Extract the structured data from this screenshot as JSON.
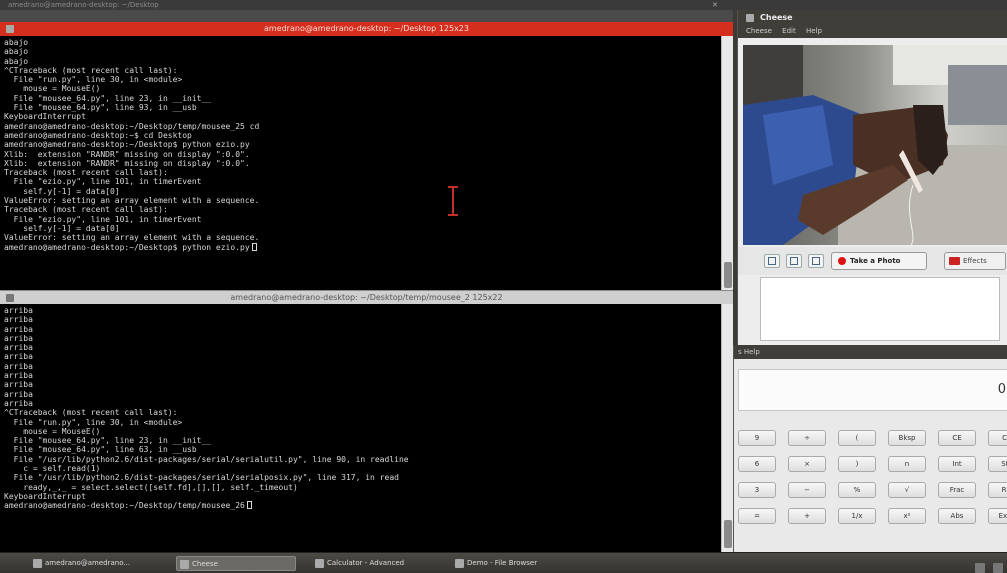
{
  "background_window": {
    "title": "amedrano@amedrano-desktop: ~/Desktop"
  },
  "terminal1": {
    "title": "amedrano@amedrano-desktop: ~/Desktop 125x23",
    "lines": [
      "abajo",
      "abajo",
      "abajo",
      "^CTraceback (most recent call last):",
      "  File \"run.py\", line 30, in <module>",
      "    mouse = MouseE()",
      "  File \"mousee_64.py\", line 23, in __init__",
      "  File \"mousee_64.py\", line 93, in __usb",
      "KeyboardInterrupt",
      "amedrano@amedrano-desktop:~/Desktop/temp/mousee_25 cd",
      "amedrano@amedrano-desktop:~$ cd Desktop",
      "amedrano@amedrano-desktop:~/Desktop$ python ezio.py",
      "Xlib:  extension \"RANDR\" missing on display \":0.0\".",
      "Xlib:  extension \"RANDR\" missing on display \":0.0\".",
      "Traceback (most recent call last):",
      "  File \"ezio.py\", line 101, in timerEvent",
      "    self.y[-1] = data[0]",
      "ValueError: setting an array element with a sequence.",
      "Traceback (most recent call last):",
      "  File \"ezio.py\", line 101, in timerEvent",
      "    self.y[-1] = data[0]",
      "ValueError: setting an array element with a sequence.",
      "amedrano@amedrano-desktop:~/Desktop$ python ezio.py"
    ]
  },
  "terminal2": {
    "title": "amedrano@amedrano-desktop: ~/Desktop/temp/mousee_2 125x22",
    "lines": [
      "arriba",
      "arriba",
      "arriba",
      "arriba",
      "arriba",
      "arriba",
      "arriba",
      "arriba",
      "arriba",
      "arriba",
      "arriba",
      "^CTraceback (most recent call last):",
      "  File \"run.py\", line 30, in <module>",
      "    mouse = MouseE()",
      "  File \"mousee_64.py\", line 23, in __init__",
      "  File \"mousee_64.py\", line 63, in __usb",
      "  File \"/usr/lib/python2.6/dist-packages/serial/serialutil.py\", line 90, in readline",
      "    c = self.read(1)",
      "  File \"/usr/lib/python2.6/dist-packages/serial/serialposix.py\", line 317, in read",
      "    ready,_,_ = select.select([self.fd],[],[], self._timeout)",
      "KeyboardInterrupt",
      "amedrano@amedrano-desktop:~/Desktop/temp/mousee_26"
    ]
  },
  "cheese": {
    "title": "Cheese",
    "menu": [
      "Cheese",
      "Edit",
      "Help"
    ],
    "take_photo_label": "Take a Photo",
    "effects_label": "Effects"
  },
  "calculator": {
    "menu": "s  Help",
    "display_value": "0",
    "buttons": [
      [
        "9",
        "÷",
        "(",
        "Bksp",
        "CE",
        "Clr"
      ],
      [
        "6",
        "×",
        ")",
        "n",
        "Int",
        "Sto"
      ],
      [
        "3",
        "−",
        "%",
        "√",
        "Frac",
        "Rcl"
      ],
      [
        "=",
        "+",
        "1/x",
        "x²",
        "Abs",
        "Exch"
      ]
    ]
  },
  "taskbar": {
    "items": [
      {
        "label": "amedrano@amedrano...",
        "active": false
      },
      {
        "label": "Cheese",
        "active": true
      },
      {
        "label": "Calculator - Advanced",
        "active": false
      },
      {
        "label": "Demo - File Browser",
        "active": false
      }
    ]
  },
  "colors": {
    "active_titlebar": "#d42e1f",
    "terminal_bg": "#000000",
    "terminal_fg": "#d8d8d8",
    "panel": "#3f3e39"
  }
}
